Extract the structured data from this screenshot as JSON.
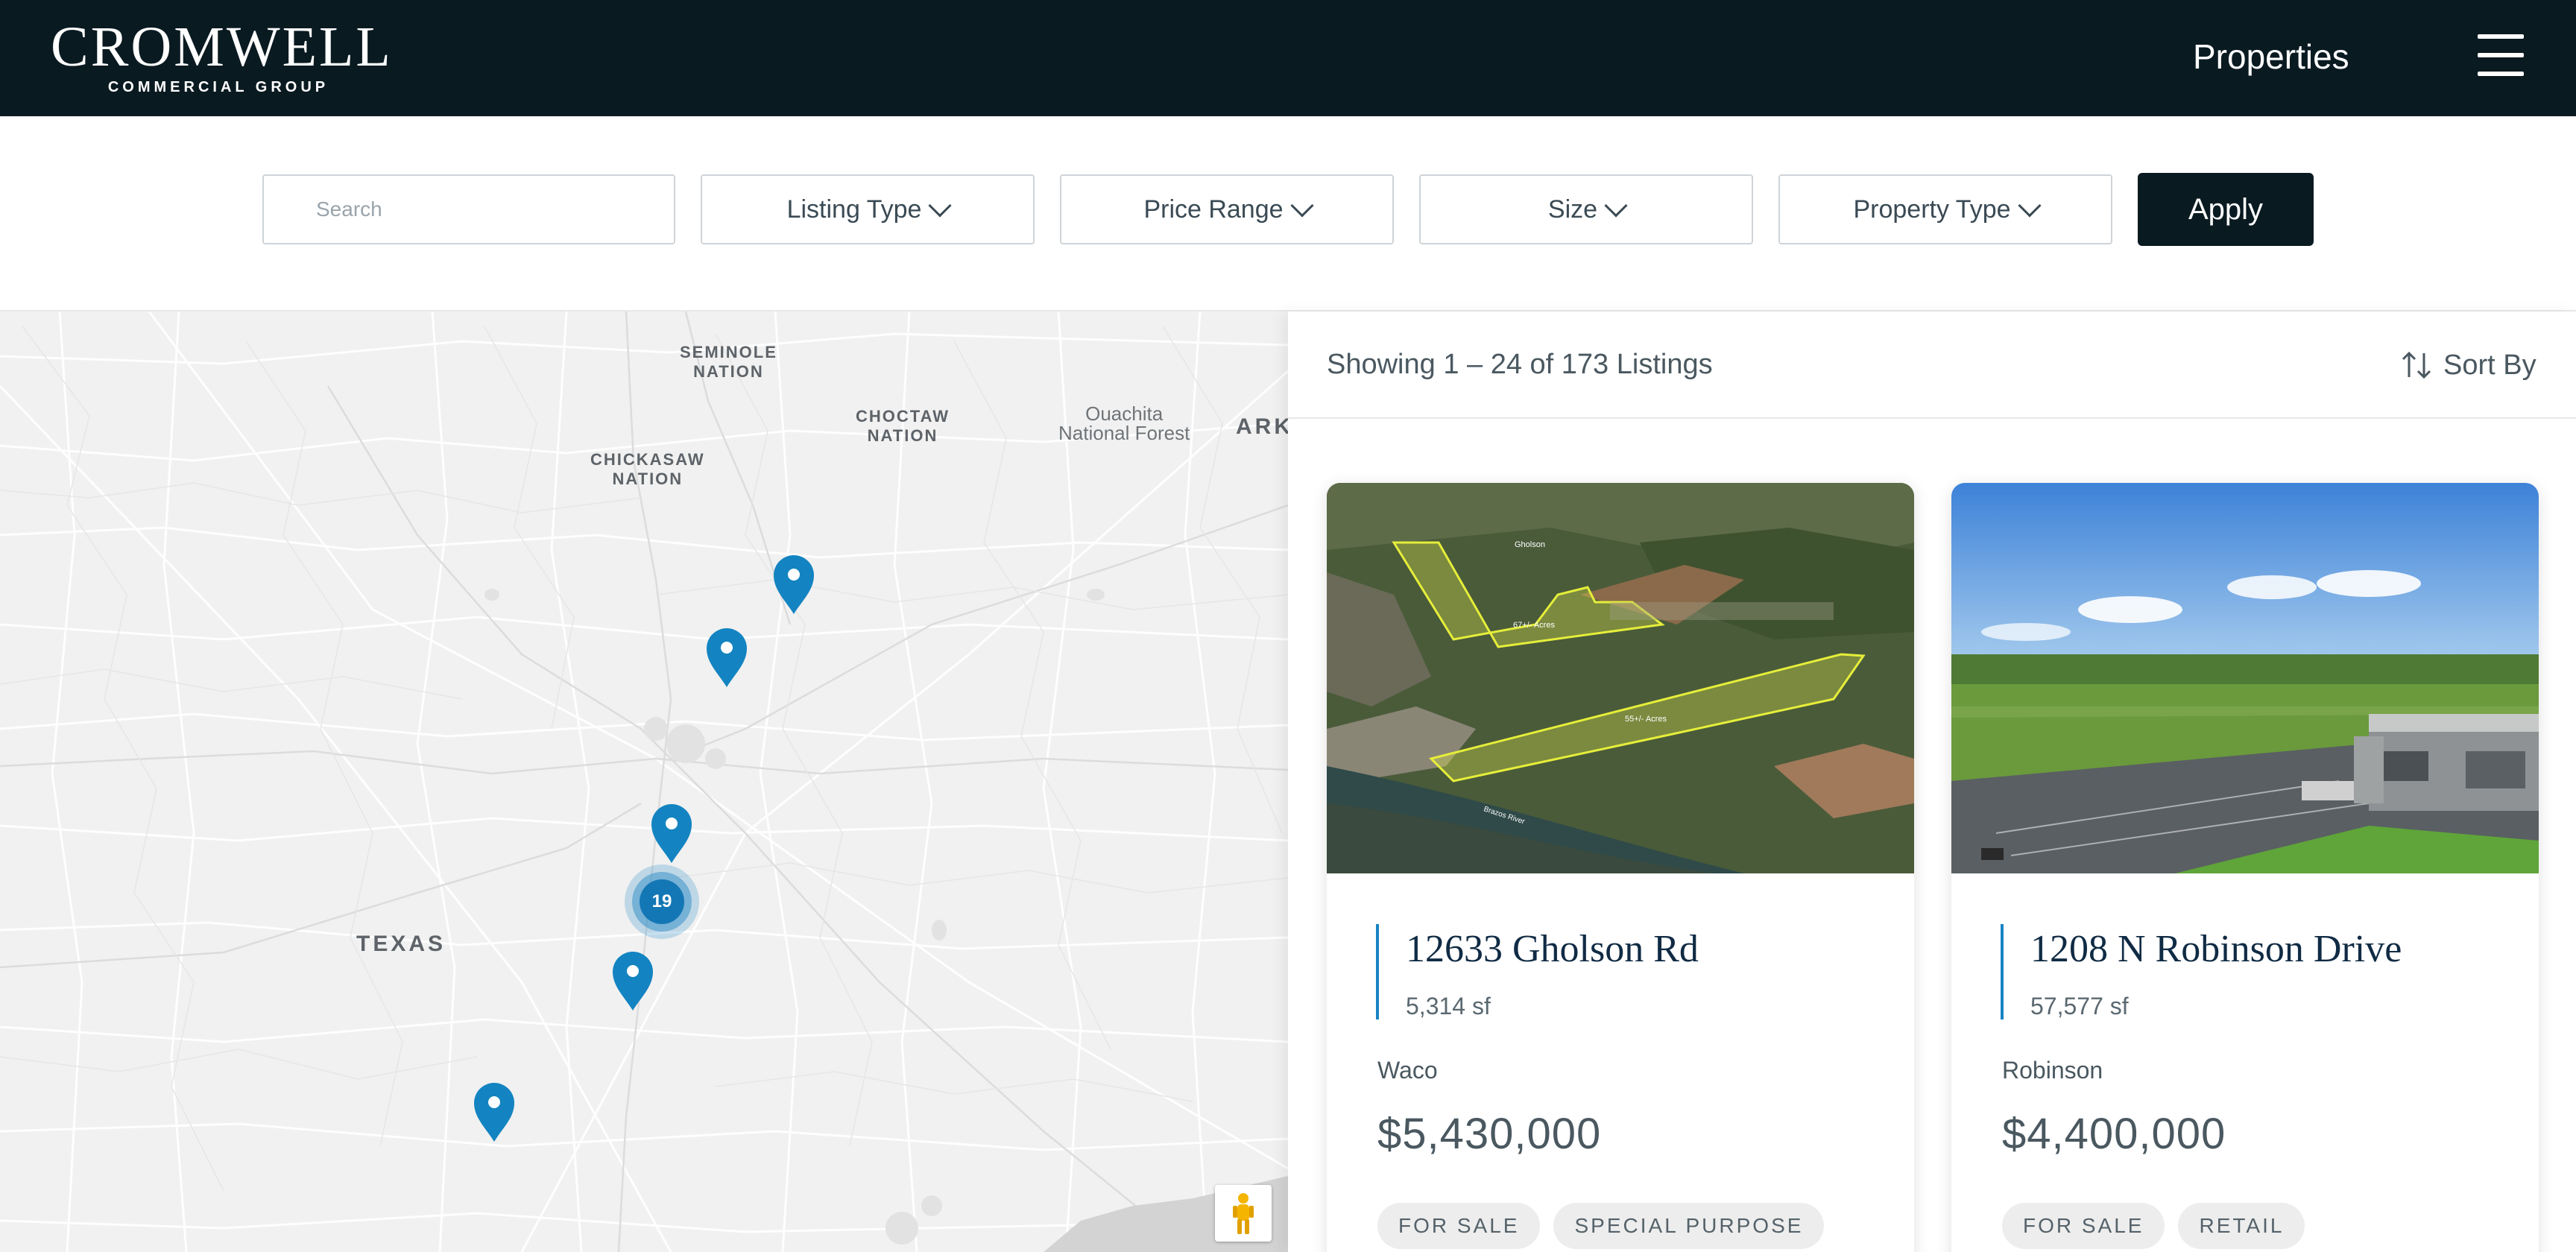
{
  "header": {
    "logo_main": "CROMWELL",
    "logo_sub": "COMMERCIAL GROUP",
    "nav_link": "Properties",
    "menu_icon": "hamburger-menu-icon"
  },
  "filters": {
    "search_placeholder": "Search",
    "listing_type": "Listing Type",
    "price_range": "Price Range",
    "size": "Size",
    "property_type": "Property Type",
    "apply": "Apply"
  },
  "map": {
    "labels": {
      "seminole": "SEMINOLE\nNATION",
      "choctaw": "CHOCTAW\nNATION",
      "chickasaw": "CHICKASAW\nNATION",
      "ouachita": "Ouachita\nNational Forest",
      "ark": "ARK",
      "texas": "TEXAS"
    },
    "cluster_count": "19",
    "accent": "#1384c1"
  },
  "results": {
    "count_text": "Showing 1 – 24 of 173 Listings",
    "sort_label": "Sort By"
  },
  "listings": [
    {
      "title": "12633 Gholson Rd",
      "size": "5,314 sf",
      "city": "Waco",
      "price": "$5,430,000",
      "tags": [
        "FOR SALE",
        "SPECIAL PURPOSE"
      ],
      "image_labels": {
        "town": "Gholson",
        "parcel_a": "67+/- Acres",
        "parcel_b": "55+/- Acres",
        "river": "Brazos River"
      }
    },
    {
      "title": "1208 N Robinson Drive",
      "size": "57,577 sf",
      "city": "Robinson",
      "price": "$4,400,000",
      "tags": [
        "FOR SALE",
        "RETAIL"
      ]
    }
  ]
}
